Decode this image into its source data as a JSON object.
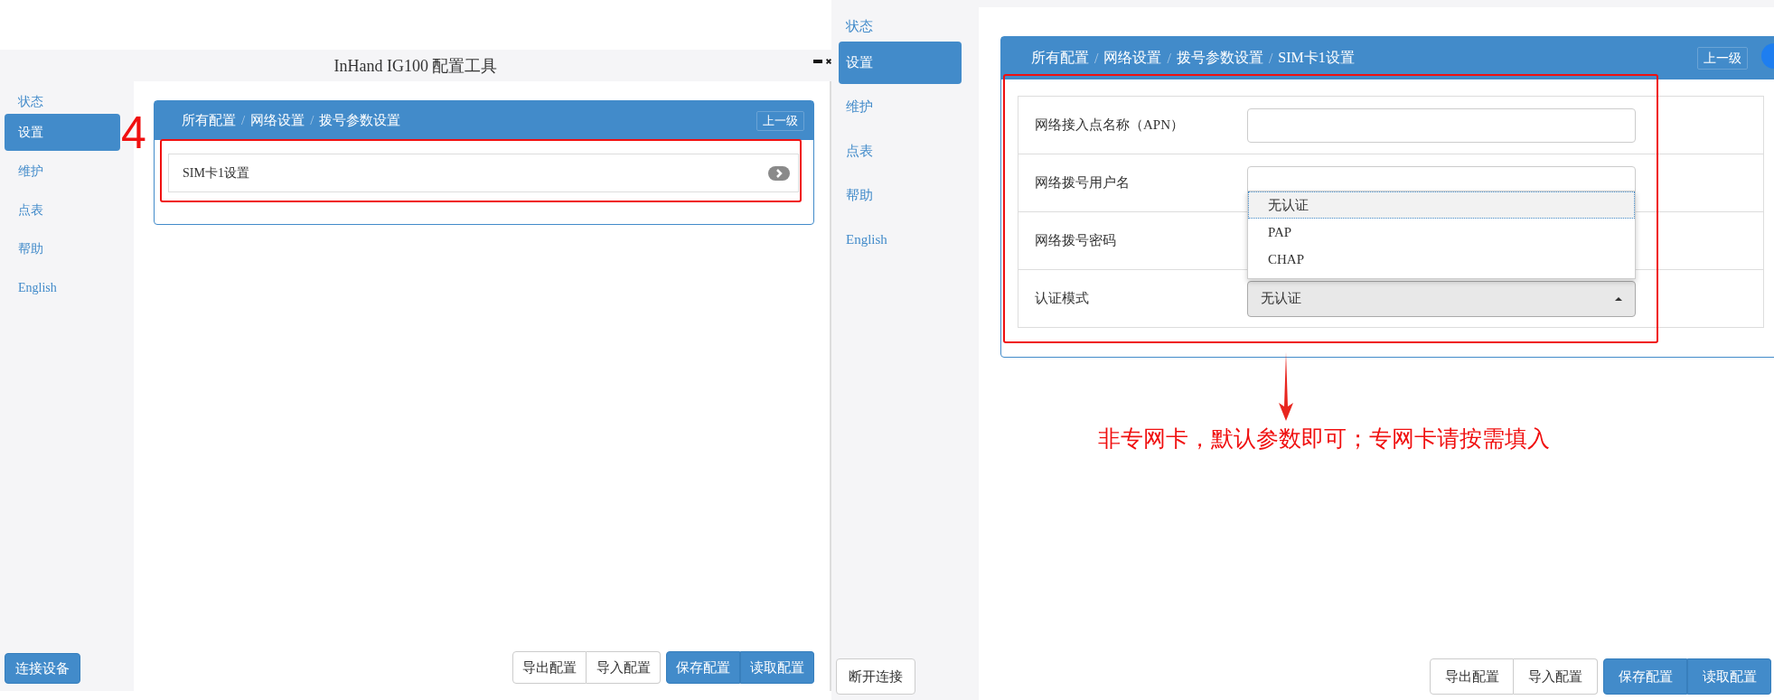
{
  "left_window": {
    "title": "InHand IG100 配置工具",
    "sidebar": {
      "items": [
        {
          "label": "状态",
          "selected": false
        },
        {
          "label": "设置",
          "selected": true
        },
        {
          "label": "维护",
          "selected": false
        },
        {
          "label": "点表",
          "selected": false
        },
        {
          "label": "帮助",
          "selected": false
        },
        {
          "label": "English",
          "selected": false
        }
      ],
      "connect_button": "连接设备"
    },
    "breadcrumb": {
      "separator": "/",
      "items": [
        "所有配置",
        "网络设置",
        "拨号参数设置"
      ]
    },
    "up_button": "上一级",
    "list_items": [
      "SIM卡1设置"
    ],
    "footer_buttons": [
      {
        "label": "导出配置",
        "kind": "default"
      },
      {
        "label": "导入配置",
        "kind": "default"
      },
      {
        "label": "保存配置",
        "kind": "primary"
      },
      {
        "label": "读取配置",
        "kind": "primary"
      }
    ]
  },
  "step_number": "4",
  "right_window": {
    "sidebar": {
      "items": [
        {
          "label": "状态",
          "selected": false
        },
        {
          "label": "设置",
          "selected": true
        },
        {
          "label": "维护",
          "selected": false
        },
        {
          "label": "点表",
          "selected": false
        },
        {
          "label": "帮助",
          "selected": false
        },
        {
          "label": "English",
          "selected": false
        }
      ],
      "disconnect_button": "断开连接"
    },
    "breadcrumb": {
      "separator": "/",
      "items": [
        "所有配置",
        "网络设置",
        "拨号参数设置",
        "SIM卡1设置"
      ]
    },
    "up_button": "上一级",
    "form": {
      "rows": [
        {
          "label": "网络接入点名称（APN）",
          "kind": "text"
        },
        {
          "label": "网络拨号用户名",
          "kind": "text"
        },
        {
          "label": "网络拨号密码",
          "kind": "covered"
        },
        {
          "label": "认证模式",
          "kind": "select",
          "value": "无认证"
        }
      ],
      "dropdown_options": [
        {
          "label": "无认证",
          "selected": true
        },
        {
          "label": "PAP",
          "selected": false
        },
        {
          "label": "CHAP",
          "selected": false
        }
      ]
    },
    "footer_buttons": [
      {
        "label": "导出配置",
        "kind": "default"
      },
      {
        "label": "导入配置",
        "kind": "default"
      },
      {
        "label": "保存配置",
        "kind": "primary"
      },
      {
        "label": "读取配置",
        "kind": "primary"
      }
    ]
  },
  "annotation": "非专网卡，默认参数即可；专网卡请按需填入"
}
